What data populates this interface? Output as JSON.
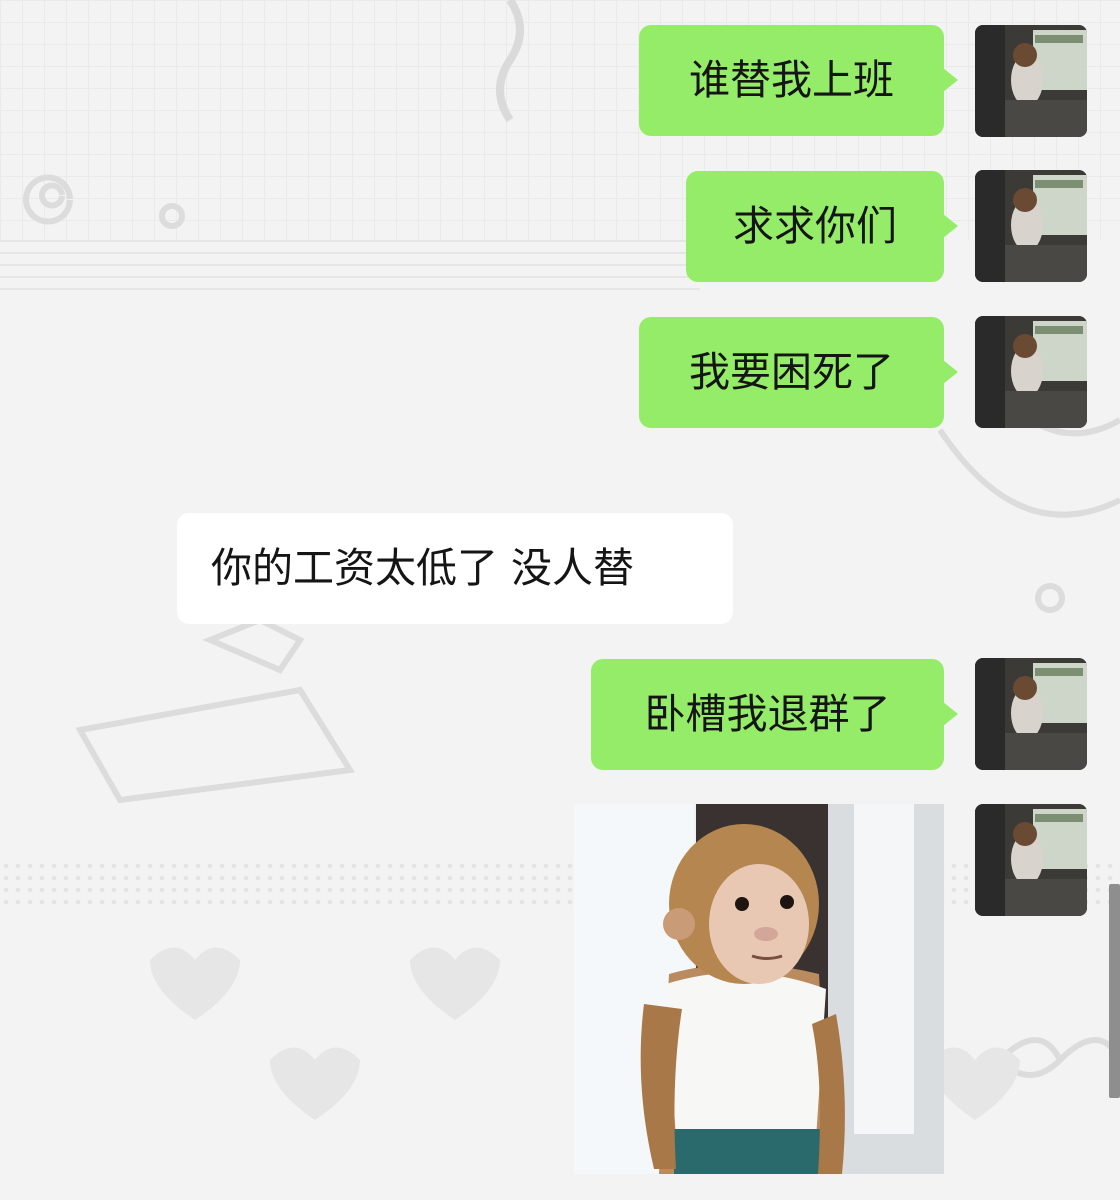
{
  "messages": [
    {
      "side": "out",
      "text": "谁替我上班"
    },
    {
      "side": "out",
      "text": "求求你们"
    },
    {
      "side": "out",
      "text": "我要困死了"
    },
    {
      "side": "in",
      "text": "你的工资太低了 没人替"
    },
    {
      "side": "out",
      "text": "卧槽我退群了"
    },
    {
      "side": "out",
      "type": "sticker",
      "icon": "monkey-sticker"
    }
  ],
  "colors": {
    "outgoing_bubble": "#95ec69",
    "incoming_bubble": "#ffffff",
    "chat_background": "#f3f3f3"
  }
}
